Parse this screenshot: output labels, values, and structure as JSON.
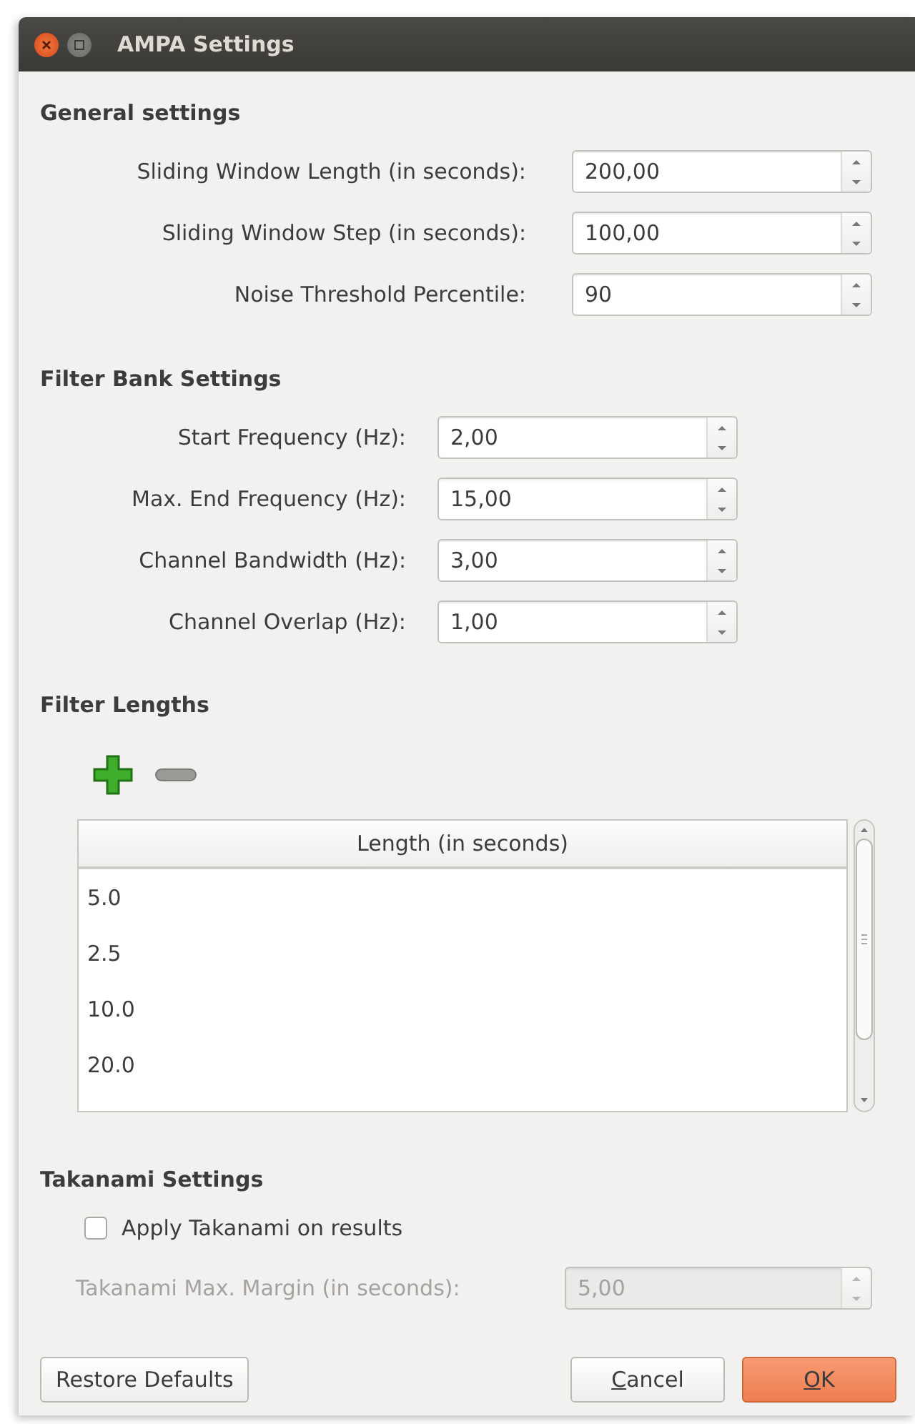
{
  "window": {
    "title": "AMPA Settings"
  },
  "general_settings": {
    "heading": "General settings",
    "fields": [
      {
        "label": "Sliding Window Length (in seconds):",
        "value": "200,00"
      },
      {
        "label": "Sliding Window Step (in seconds):",
        "value": "100,00"
      },
      {
        "label": "Noise Threshold Percentile:",
        "value": "90"
      }
    ]
  },
  "filter_bank_settings": {
    "heading": "Filter Bank Settings",
    "fields": [
      {
        "label": "Start Frequency (Hz):",
        "value": "2,00"
      },
      {
        "label": "Max. End Frequency (Hz):",
        "value": "15,00"
      },
      {
        "label": "Channel Bandwidth (Hz):",
        "value": "3,00"
      },
      {
        "label": "Channel Overlap (Hz):",
        "value": "1,00"
      }
    ]
  },
  "filter_lengths": {
    "heading": "Filter Lengths",
    "table": {
      "columns": [
        "Length (in seconds)"
      ],
      "rows": [
        "5.0",
        "2.5",
        "10.0",
        "20.0"
      ]
    }
  },
  "takanami_settings": {
    "heading": "Takanami Settings",
    "checkbox": {
      "label": "Apply Takanami on results",
      "checked": false
    },
    "field": {
      "label": "Takanami Max. Margin (in seconds):",
      "value": "5,00",
      "disabled": true
    }
  },
  "left_buttons": [
    {
      "label": "Restore Defaults",
      "mnemonic": false,
      "default": false
    }
  ],
  "right_buttons": [
    {
      "label": "Cancel",
      "mnemonic": true,
      "default": false
    },
    {
      "label": "OK",
      "mnemonic": true,
      "default": true
    }
  ]
}
